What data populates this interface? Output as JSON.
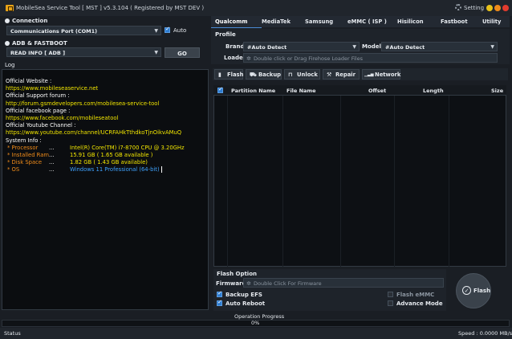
{
  "window": {
    "title": "MobileSea Service Tool [ MST ] v5.3.104 ( Registered by MST DEV )",
    "setting_label": "Setting",
    "controls": [
      {
        "name": "minimize",
        "color": "#e8c21a"
      },
      {
        "name": "maximize",
        "color": "#f08c1a"
      },
      {
        "name": "close",
        "color": "#e23b2e"
      }
    ]
  },
  "connection": {
    "label": "Connection",
    "port_value": "Communications Port (COM1)",
    "auto_label": "Auto",
    "auto_checked": true
  },
  "adb": {
    "label": "ADB & FASTBOOT",
    "command_value": "READ INFO [ ADB ]",
    "go_label": "GO"
  },
  "log": {
    "label": "Log",
    "lines": [
      {
        "text": "Official Website :",
        "color": "#ffffff"
      },
      {
        "text": "https://www.mobileseaservice.net",
        "color": "#f2e600"
      },
      {
        "text": "Official Support forum :",
        "color": "#ffffff"
      },
      {
        "text": "http://forum.gsmdevelopers.com/mobilesea-service-tool",
        "color": "#f2e600"
      },
      {
        "text": "Official facebook page :",
        "color": "#ffffff"
      },
      {
        "text": "https://www.facebook.com/mobileseatool",
        "color": "#f2e600"
      },
      {
        "text": "Official Youtube Channel :",
        "color": "#ffffff"
      },
      {
        "text": "https://www.youtube.com/channel/UCRFAHkTthdkoTjnOikvAMuQ",
        "color": "#f2e600"
      },
      {
        "text": "System Info :",
        "color": "#ffffff"
      }
    ],
    "system_info": [
      {
        "key": "* Processor",
        "dots": "...",
        "value": "Intel(R) Core(TM) i7-8700 CPU @ 3.20GHz",
        "color": "#f2e600"
      },
      {
        "key": "* Installed Ram",
        "dots": "...",
        "value": "15.91 GB  ( 1.65 GB  available )",
        "color": "#f2e600"
      },
      {
        "key": "* Disk Space",
        "dots": "...",
        "value": "1.82 GB ( 1.43 GB  available)",
        "color": "#f2e600"
      },
      {
        "key": "* OS",
        "dots": "...",
        "value": "Windows 11 Professional (64-bit)",
        "color": "#3fa3ff"
      }
    ],
    "key_color": "#f08c1a"
  },
  "tabs": [
    {
      "label": "Qualcomm",
      "active": true
    },
    {
      "label": "MediaTek",
      "active": false
    },
    {
      "label": "Samsung",
      "active": false
    },
    {
      "label": "eMMC ( ISP )",
      "active": false
    },
    {
      "label": "Hisilicon",
      "active": false
    },
    {
      "label": "Fastboot",
      "active": false
    },
    {
      "label": "Utility",
      "active": false
    }
  ],
  "profile": {
    "label": "Profile",
    "brand_label": "Brand",
    "brand_value": "#Auto Detect",
    "model_label": "Model",
    "model_value": "#Auto Detect",
    "loader_label": "Loader",
    "loader_placeholder": "Double click or Drag Firehose Loader Files"
  },
  "operations": [
    {
      "label": "Flash",
      "icon": "flash-icon"
    },
    {
      "label": "Backup",
      "icon": "backup-icon"
    },
    {
      "label": "Unlock",
      "icon": "unlock-icon"
    },
    {
      "label": "Repair",
      "icon": "repair-icon"
    },
    {
      "label": "Network",
      "icon": "network-icon"
    }
  ],
  "partition_table": {
    "columns": [
      "Partition Name",
      "File Name",
      "Offset",
      "Length",
      "Size"
    ],
    "select_all_checked": true
  },
  "flash_option": {
    "label": "Flash Option",
    "firmware_label": "Firmware",
    "firmware_placeholder": "Double Click For Firmware",
    "backup_efs_label": "Backup EFS",
    "backup_efs_checked": true,
    "auto_reboot_label": "Auto Reboot",
    "auto_reboot_checked": true,
    "flash_emmc_label": "Flash eMMC",
    "flash_emmc_checked": false,
    "advance_mode_label": "Advance Mode",
    "advance_mode_checked": false,
    "flash_button_label": "Flash"
  },
  "progress": {
    "label": "Operation Progress",
    "percent_text": "0%",
    "value": 0
  },
  "status": {
    "label": "Status",
    "speed_text": "Speed : 0.0000 MB/s"
  }
}
